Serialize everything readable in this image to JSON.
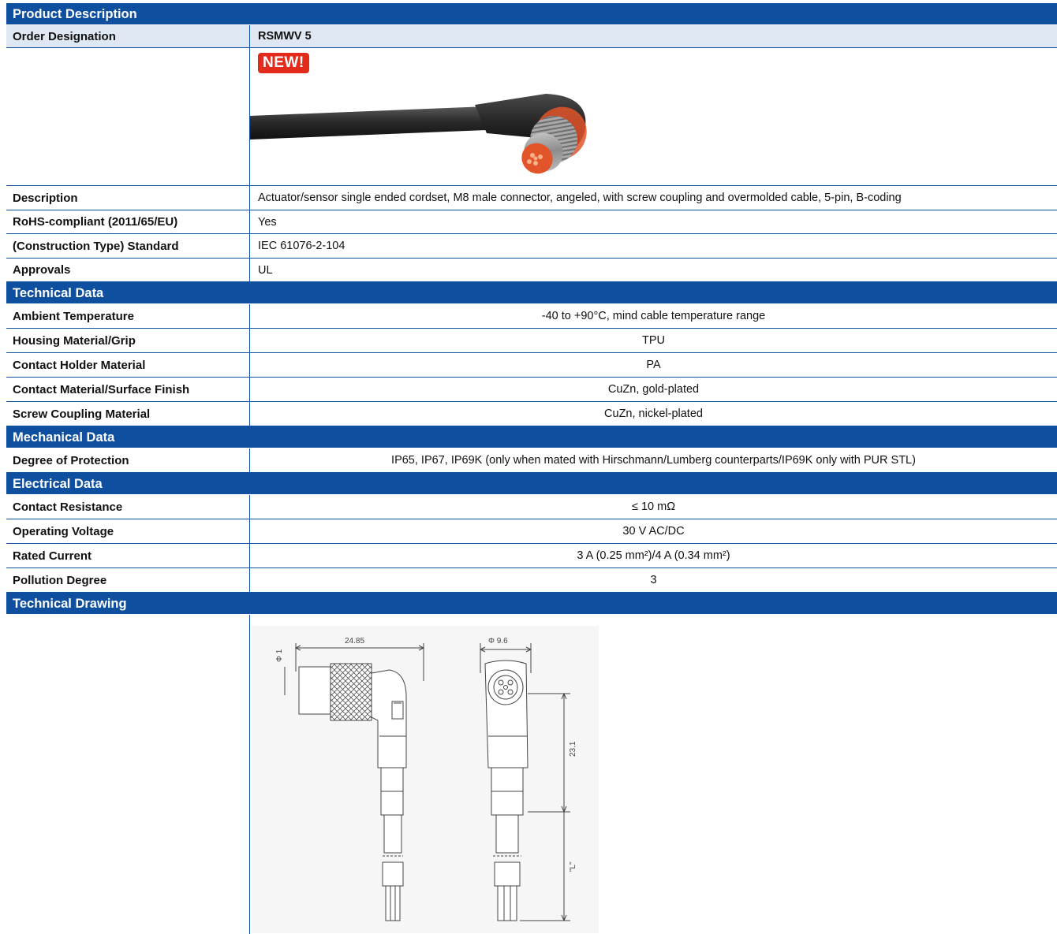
{
  "sections": {
    "product_description": "Product Description",
    "technical_data": "Technical Data",
    "mechanical_data": "Mechanical Data",
    "electrical_data": "Electrical Data",
    "technical_drawing": "Technical Drawing"
  },
  "order": {
    "label": "Order Designation",
    "value": "RSMWV 5"
  },
  "badge": "NEW!",
  "product": [
    {
      "label": "Description",
      "value": "Actuator/sensor single ended cordset, M8 male connector, angeled, with screw coupling and overmolded cable, 5-pin, B-coding"
    },
    {
      "label": "RoHS-compliant (2011/65/EU)",
      "value": "Yes"
    },
    {
      "label": "(Construction Type) Standard",
      "value": "IEC 61076-2-104"
    },
    {
      "label": "Approvals",
      "value": "UL"
    }
  ],
  "technical": [
    {
      "label": "Ambient Temperature",
      "value": "-40 to +90°C, mind cable temperature range"
    },
    {
      "label": "Housing Material/Grip",
      "value": "TPU"
    },
    {
      "label": "Contact Holder Material",
      "value": "PA"
    },
    {
      "label": "Contact Material/Surface Finish",
      "value": "CuZn, gold-plated"
    },
    {
      "label": "Screw Coupling Material",
      "value": "CuZn, nickel-plated"
    }
  ],
  "mechanical": [
    {
      "label": "Degree of Protection",
      "value": "IP65, IP67, IP69K (only when mated with Hirschmann/Lumberg counterparts/IP69K only with PUR STL)"
    }
  ],
  "electrical": [
    {
      "label": "Contact Resistance",
      "value": "≤ 10 mΩ"
    },
    {
      "label": "Operating Voltage",
      "value": "30 V AC/DC"
    },
    {
      "label": "Rated Current",
      "value": "3 A (0.25 mm²)/4 A (0.34 mm²)"
    },
    {
      "label": "Pollution Degree",
      "value": "3"
    }
  ],
  "drawing": {
    "dim_length": "24.85",
    "dim_small": "Φ 1",
    "dim_diameter": "Φ 9.6",
    "dim_height": "23.1",
    "dim_cable": "\"L\""
  },
  "colors": {
    "header_blue": "#0f4fa0",
    "badge_red": "#e42b1b",
    "connector_orange": "#e2542a"
  }
}
